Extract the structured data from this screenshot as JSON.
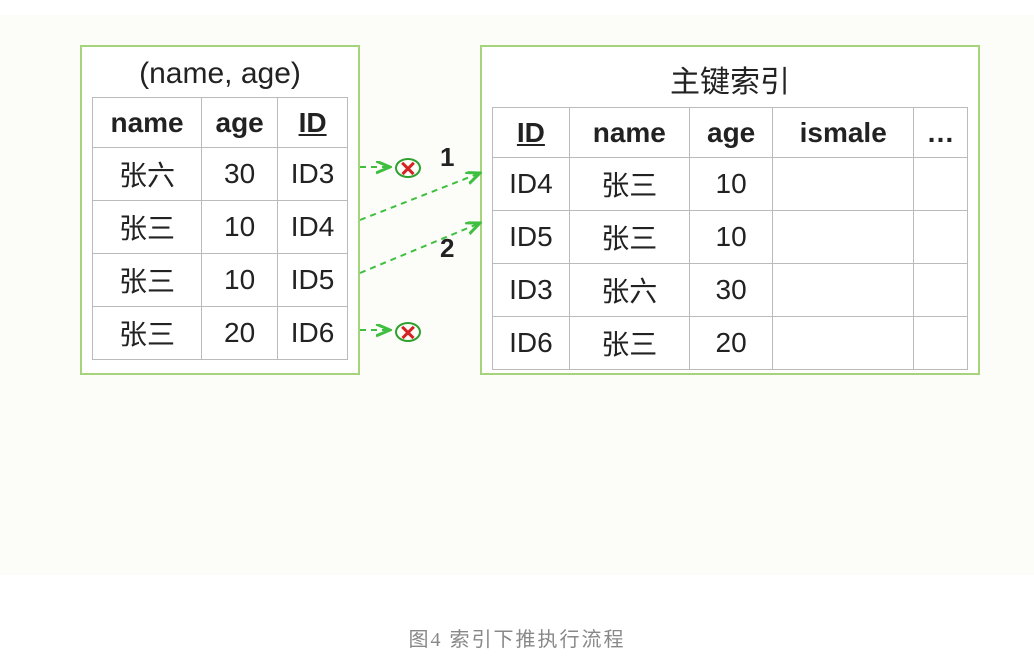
{
  "left_box": {
    "title": "(name, age)",
    "headers": [
      "name",
      "age",
      "ID"
    ],
    "underline_header_idx": 2,
    "rows": [
      [
        "张六",
        "30",
        "ID3"
      ],
      [
        "张三",
        "10",
        "ID4"
      ],
      [
        "张三",
        "10",
        "ID5"
      ],
      [
        "张三",
        "20",
        "ID6"
      ]
    ]
  },
  "right_box": {
    "title": "主键索引",
    "headers": [
      "ID",
      "name",
      "age",
      "ismale",
      "…"
    ],
    "underline_header_idx": 0,
    "rows": [
      [
        "ID4",
        "张三",
        "10",
        "",
        ""
      ],
      [
        "ID5",
        "张三",
        "10",
        "",
        ""
      ],
      [
        "ID3",
        "张六",
        "30",
        "",
        ""
      ],
      [
        "ID6",
        "张三",
        "20",
        "",
        ""
      ]
    ]
  },
  "arrows": {
    "label1": "1",
    "label2": "2"
  },
  "caption": "图4 索引下推执行流程",
  "colors": {
    "border_green": "#a6d47a",
    "dash_green": "#3fbf3f",
    "reject_red": "#d62222",
    "cell_border": "#bbbbbb"
  }
}
